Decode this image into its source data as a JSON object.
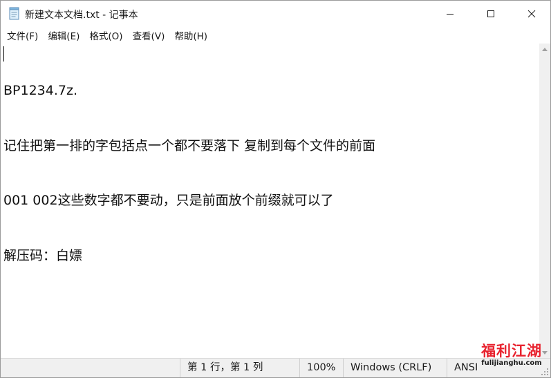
{
  "window": {
    "title": "新建文本文档.txt - 记事本"
  },
  "menu": [
    {
      "label": "文件(F)"
    },
    {
      "label": "编辑(E)"
    },
    {
      "label": "格式(O)"
    },
    {
      "label": "查看(V)"
    },
    {
      "label": "帮助(H)"
    }
  ],
  "editor": {
    "lines": [
      "BP1234.7z.",
      "记住把第一排的字包括点一个都不要落下 复制到每个文件的前面",
      "001 002这些数字都不要动，只是前面放个前缀就可以了",
      "解压码：白嫖"
    ]
  },
  "status": {
    "position": "第 1 行，第 1 列",
    "zoom": "100%",
    "line_ending": "Windows (CRLF)",
    "encoding": "ANSI"
  },
  "watermark": {
    "logo": "福利江湖",
    "url": "fulijianghu.com"
  },
  "colors": {
    "watermark_red": "#e8232f",
    "watermark_blue": "#1c7ed8"
  }
}
